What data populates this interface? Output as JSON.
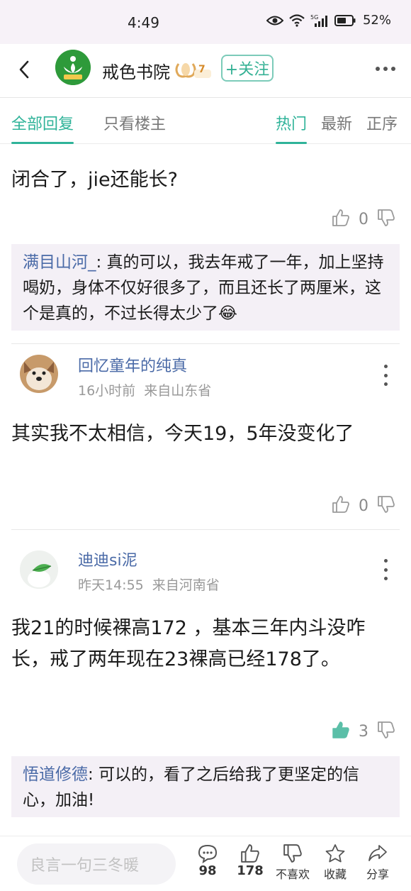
{
  "status": {
    "time": "4:49",
    "network": "5G",
    "battery": "52%"
  },
  "header": {
    "forum_name": "戒色书院",
    "level": "7",
    "follow_label": "+关注"
  },
  "tabs": {
    "left": [
      {
        "label": "全部回复",
        "active": true
      },
      {
        "label": "只看楼主",
        "active": false
      }
    ],
    "right": [
      {
        "label": "热门",
        "active": true
      },
      {
        "label": "最新",
        "active": false
      },
      {
        "label": "正序",
        "active": false
      }
    ]
  },
  "floors": [
    {
      "content": "闭合了，jie还能长?",
      "likes": "0",
      "reply": {
        "author": "满目山河_",
        "text": ": 真的可以，我去年戒了一年，加上坚持喝奶，身体不仅好很多了，而且还长了两厘米，这个是真的，不过长得太少了😂"
      }
    },
    {
      "user": "回忆童年的纯真",
      "time": "16小时前",
      "location": "来自山东省",
      "content": "其实我不太相信，今天19，5年没变化了",
      "likes": "0"
    },
    {
      "user": "迪迪si泥",
      "time": "昨天14:55",
      "location": "来自河南省",
      "content": "我21的时候裸高172 ，基本三年内斗没咋长，戒了两年现在23裸高已经178了。",
      "likes": "3",
      "reply": {
        "author": "悟道修德",
        "text": ": 可以的，看了之后给我了更坚定的信心，加油!"
      }
    }
  ],
  "bottom_bar": {
    "input_placeholder": "良言一句三冬暖",
    "comment_count": "98",
    "like_count": "178",
    "dislike_label": "不喜欢",
    "favorite_label": "收藏",
    "share_label": "分享"
  },
  "colors": {
    "accent": "#2fb399",
    "username": "#4a6aa7",
    "reply_bg": "#f4f0f6",
    "status_bg": "#f7f2f8"
  }
}
